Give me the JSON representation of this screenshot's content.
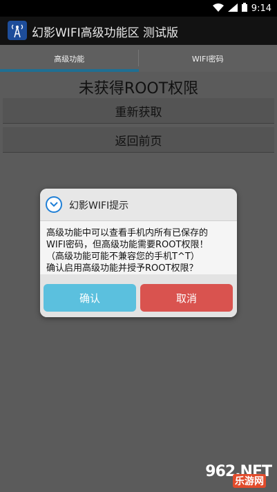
{
  "status_bar": {
    "time": "9:14",
    "icons": [
      "wifi-icon",
      "signal-icon",
      "battery-icon"
    ]
  },
  "action_bar": {
    "title": "幻影WIFI高级功能区 测试版",
    "icon": "wifi-tower-icon"
  },
  "tabs": [
    {
      "label": "高级功能",
      "active": true
    },
    {
      "label": "WIFI密码",
      "active": false
    }
  ],
  "main": {
    "status_text": "未获得ROOT权限",
    "retry_label": "重新获取",
    "back_label": "返回前页"
  },
  "dialog": {
    "title": "幻影WIFI提示",
    "message_lines": [
      "高级功能中可以查看手机内所有已保存的",
      "WIFI密码，但高级功能需要ROOT权限！",
      "（高级功能可能不兼容您的手机T^T）",
      "确认启用高级功能并授予ROOT权限？"
    ],
    "confirm_label": "确认",
    "cancel_label": "取消"
  },
  "watermark": {
    "text": "962.NET",
    "sub": "乐游网"
  },
  "colors": {
    "accent_tab": "#1f6f93",
    "confirm_button": "#5bc0de",
    "cancel_button": "#d9534f"
  }
}
